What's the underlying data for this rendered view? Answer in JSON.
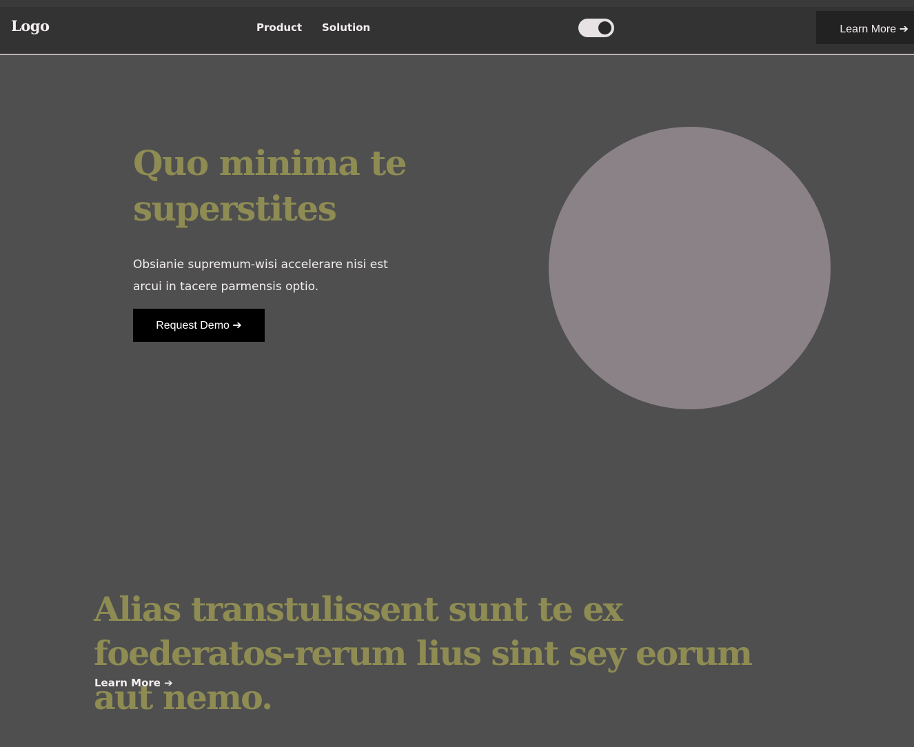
{
  "header": {
    "logo": "Logo",
    "nav": [
      {
        "label": "Product"
      },
      {
        "label": "Solution"
      }
    ],
    "theme_toggle": {
      "state": "on"
    },
    "cta_label": "Learn More ➔"
  },
  "hero": {
    "title": "Quo minima te superstites",
    "description": "Obsianie supremum-wisi accelerare nisi est arcui in tacere parmensis optio.",
    "button_label": "Request Demo ➔"
  },
  "section": {
    "title": "Alias transtulissent sunt te ex foederatos-rerum lius sint sey eorum aut nemo.",
    "link_label": "Learn More ➔"
  },
  "colors": {
    "page_background": "#4f4f4f",
    "navbar_background": "#333333",
    "accent_text": "#8e8c53",
    "circle": "#8b8288",
    "button_dark": "#000000"
  }
}
